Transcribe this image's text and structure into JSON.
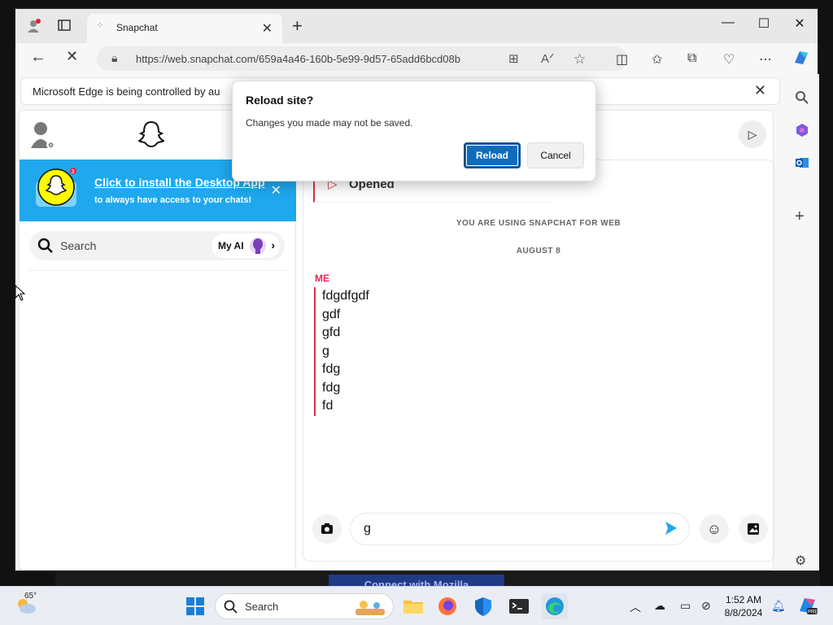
{
  "browser": {
    "tab_title": "Snapchat",
    "url": "https://web.snapchat.com/659a4a46-160b-5e99-9d57-65add6bcd08b",
    "infobar_text": "Microsoft Edge is being controlled by au"
  },
  "dialog": {
    "title": "Reload site?",
    "message": "Changes you made may not be saved.",
    "reload_label": "Reload",
    "cancel_label": "Cancel"
  },
  "left_pane": {
    "banner_title": "Click to install the Desktop App",
    "banner_subtitle": "to always have access to your chats!",
    "banner_badge": "3",
    "search_label": "Search",
    "my_ai_label": "My AI"
  },
  "chat": {
    "opened_label": "Opened",
    "info_text": "YOU ARE USING SNAPCHAT FOR WEB",
    "date_label": "AUGUST 8",
    "sender_label": "ME",
    "messages": [
      "fdgdfgdf",
      "gdf",
      "gfd",
      "g",
      "fdg",
      "fdg",
      "fd"
    ],
    "composer_value": "g"
  },
  "taskbar": {
    "temperature": "65°",
    "search_label": "Search",
    "time": "1:52 AM",
    "date": "8/8/2024"
  },
  "background": {
    "mozilla_text": "Connect with Mozilla"
  },
  "colors": {
    "snap_blue": "#1fa8ee",
    "edge_accent": "#0f6cbd",
    "me_red": "#e0284f",
    "opened_red": "#d6363f"
  }
}
